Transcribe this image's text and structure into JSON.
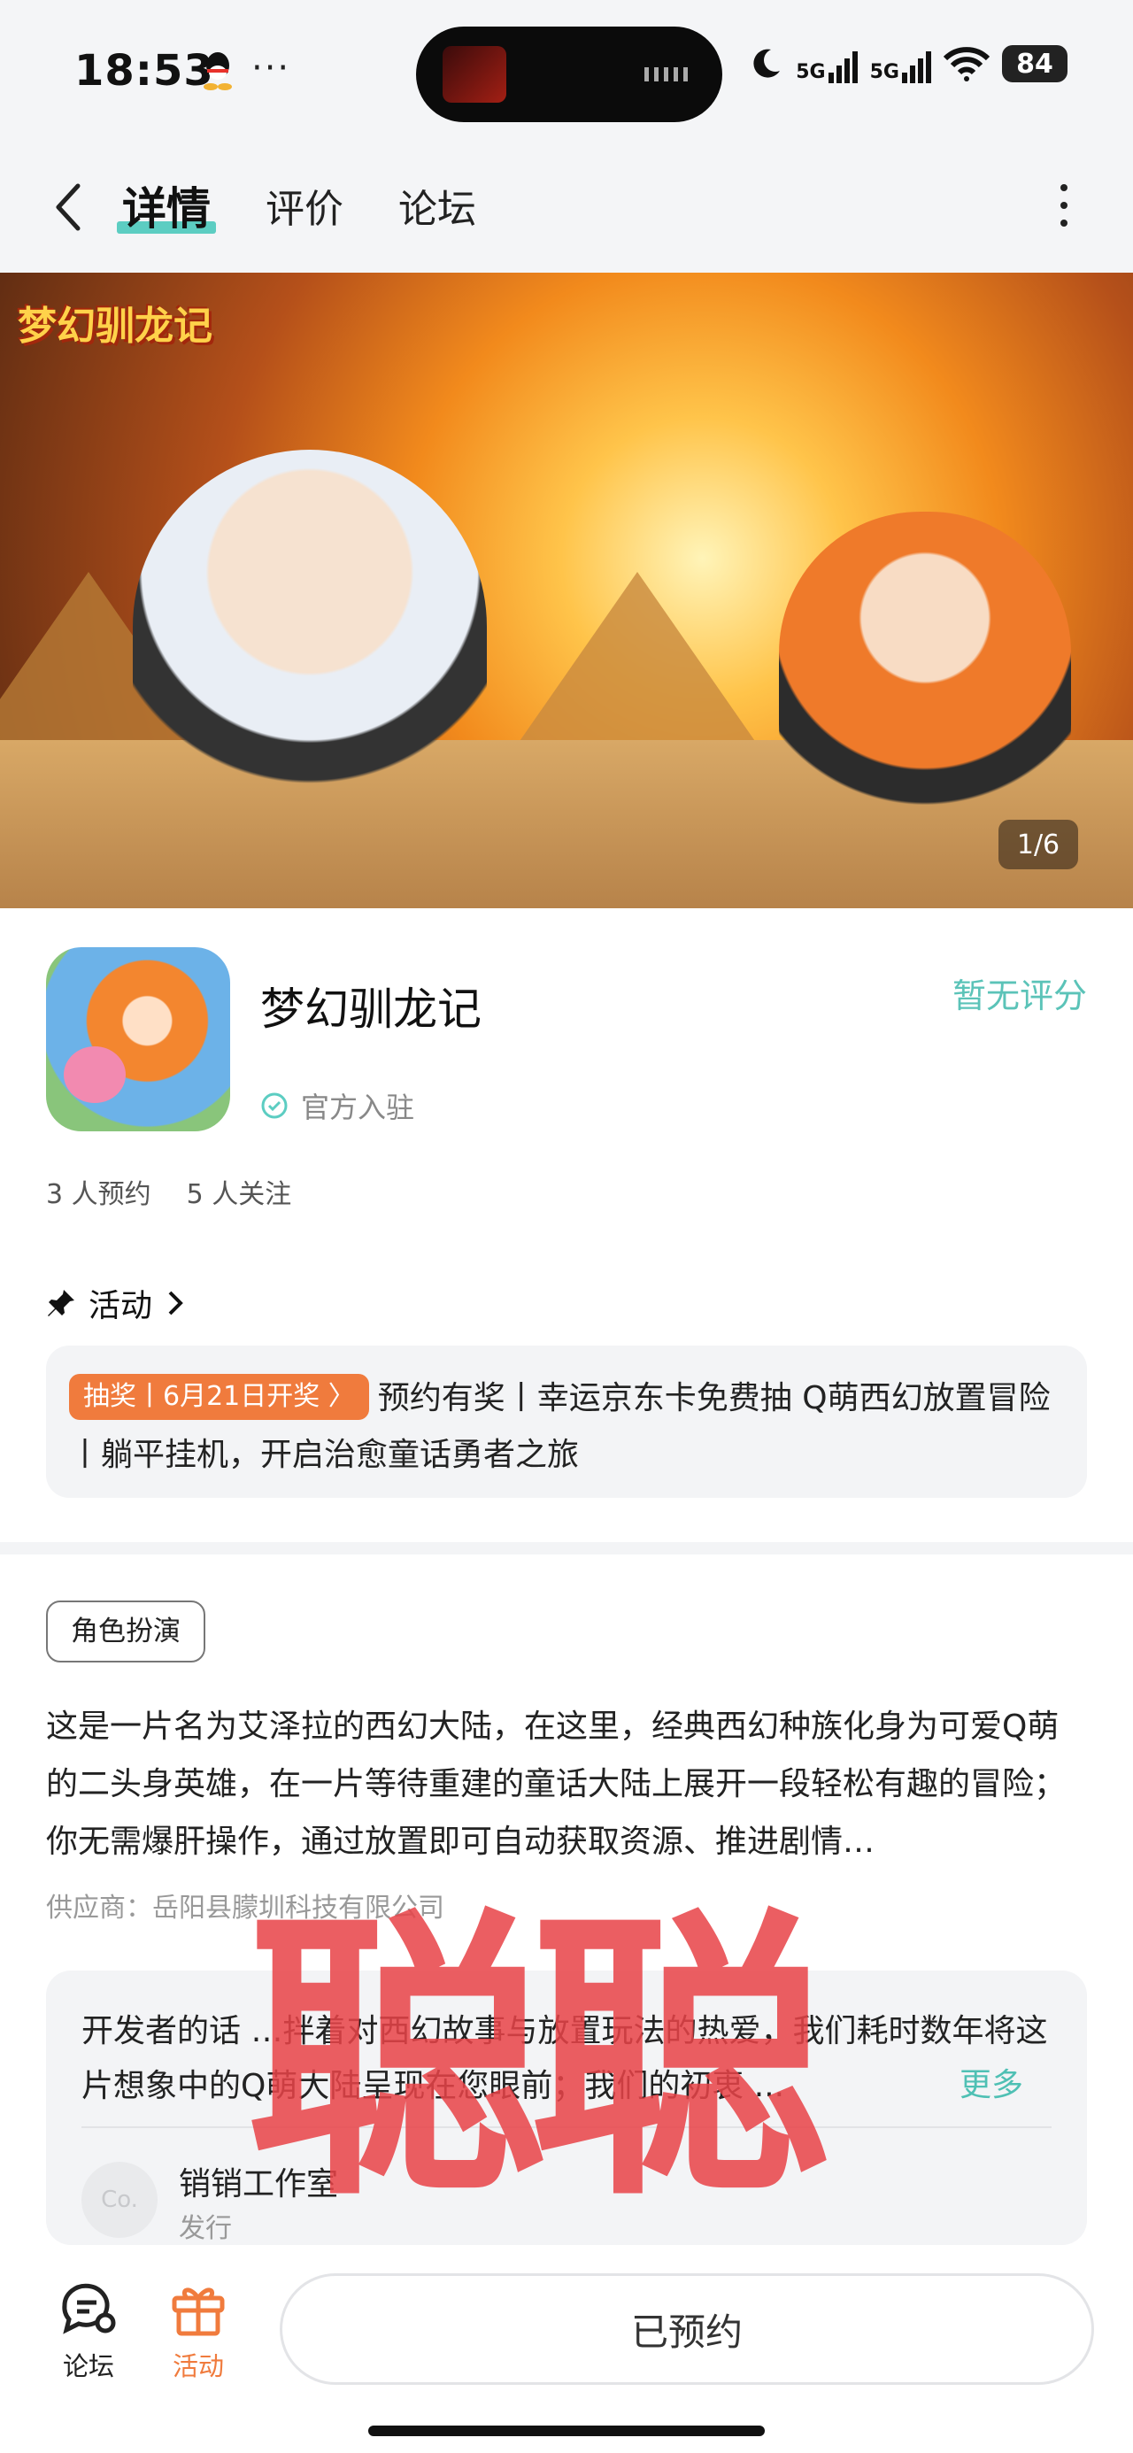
{
  "status_bar": {
    "time": "18:53",
    "more": "···",
    "battery": "84",
    "net1": "5G",
    "net2": "5G"
  },
  "nav": {
    "tabs": [
      {
        "label": "详情",
        "active": true
      },
      {
        "label": "评价"
      },
      {
        "label": "论坛"
      }
    ]
  },
  "banner": {
    "logo_text": "梦幻驯龙记",
    "counter": "1/6"
  },
  "game": {
    "title": "梦幻驯龙记",
    "rating": "暂无评分",
    "official": "官方入驻",
    "reservations": "3 人预约",
    "followers": "5 人关注"
  },
  "activity": {
    "heading": "活动",
    "badge": "抽奖丨6月21日开奖 〉",
    "text": "预约有奖丨幸运京东卡免费抽 Q萌西幻放置冒险丨躺平挂机，开启治愈童话勇者之旅"
  },
  "description": {
    "tag": "角色扮演",
    "text": "这是一片名为艾泽拉的西幻大陆，在这里，经典西幻种族化身为可爱Q萌的二头身英雄，在一片等待重建的童话大陆上展开一段轻松有趣的冒险；你无需爆肝操作，通过放置即可自动获取资源、推进剧情…",
    "supplier": "供应商：岳阳县朦圳科技有限公司"
  },
  "developer": {
    "text": "开发者的话  …拌着对西幻故事与放置玩法的热爱，我们耗时数年将这片想象中的Q萌大陆呈现在您眼前；我们的初衷 ...",
    "more": "更多",
    "avatar": "Co.",
    "name": "销销工作室",
    "role": "发行"
  },
  "watermark": "聪聪",
  "bottom": {
    "forum": "论坛",
    "activity": "活动",
    "reserve": "已预约"
  },
  "colors": {
    "accent": "#5ccdc2",
    "orange": "#f07b3d",
    "watermark": "#e84448"
  }
}
